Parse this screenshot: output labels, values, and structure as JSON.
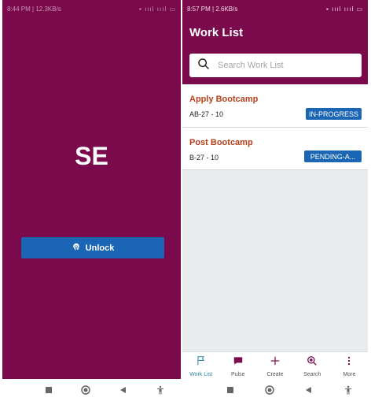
{
  "lock_screen": {
    "status_time": "8:44 PM | 12.3KB/s",
    "logo_text": "SE",
    "unlock_label": "Unlock"
  },
  "work_list": {
    "status_time": "8:57 PM | 2.6KB/s",
    "title": "Work List",
    "search_placeholder": "Search Work List",
    "items": [
      {
        "title": "Apply Bootcamp",
        "id": "AB-27 - 10",
        "status": "IN-PROGRESS"
      },
      {
        "title": "Post Bootcamp",
        "id": "B-27 - 10",
        "status": "PENDING-A..."
      }
    ],
    "tabs": [
      {
        "label": "Work List",
        "icon": "flag-icon",
        "active": true
      },
      {
        "label": "Pulse",
        "icon": "chat-icon",
        "active": false
      },
      {
        "label": "Create",
        "icon": "plus-icon",
        "active": false
      },
      {
        "label": "Search",
        "icon": "search-icon",
        "active": false
      },
      {
        "label": "More",
        "icon": "more-vertical-icon",
        "active": false
      }
    ]
  },
  "colors": {
    "brand": "#7a0a4c",
    "button": "#1a66b5",
    "item_title": "#b5401b",
    "active_tab": "#2a8aa8"
  }
}
